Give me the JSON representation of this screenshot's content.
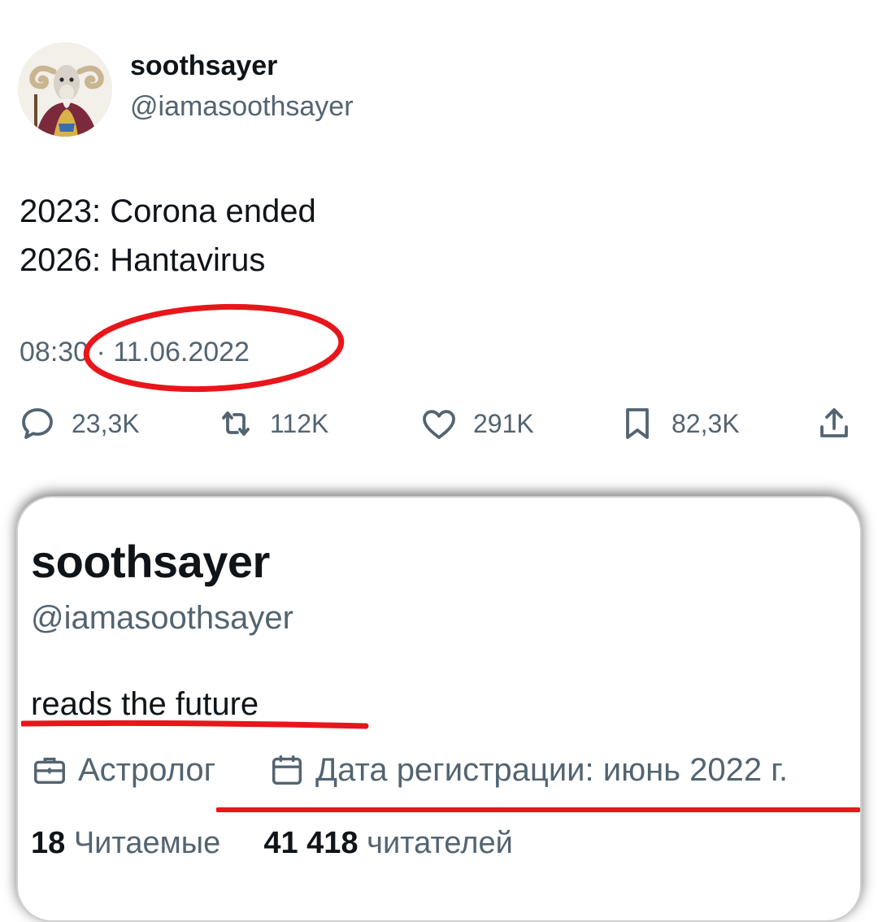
{
  "tweet": {
    "display_name": "soothsayer",
    "handle": "@iamasoothsayer",
    "lines": [
      "2023: Corona ended",
      "2026: Hantavirus"
    ],
    "time": "08:30",
    "separator": "·",
    "date": "11.06.2022",
    "actions": {
      "reply": {
        "icon": "reply-icon",
        "count": "23,3K"
      },
      "retweet": {
        "icon": "retweet-icon",
        "count": "112K"
      },
      "like": {
        "icon": "heart-icon",
        "count": "291K"
      },
      "bookmark": {
        "icon": "bookmark-icon",
        "count": "82,3K"
      },
      "share": {
        "icon": "share-icon"
      }
    }
  },
  "profile": {
    "display_name": "soothsayer",
    "handle": "@iamasoothsayer",
    "bio": "reads the future",
    "profession": {
      "icon": "briefcase-icon",
      "text": "Астролог"
    },
    "joined": {
      "icon": "calendar-icon",
      "text": "Дата регистрации: июнь 2022 г."
    },
    "following": {
      "count": "18",
      "label": "Читаемые"
    },
    "followers": {
      "count": "41 418",
      "label": "читателей"
    }
  },
  "colors": {
    "text": "#0f1419",
    "secondary": "#536471",
    "annotation_red": "#e8161b"
  }
}
